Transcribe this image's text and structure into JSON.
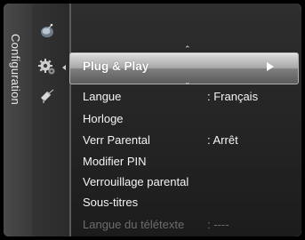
{
  "sidebar": {
    "title": "Configuration",
    "icons": [
      "antenna-icon",
      "gear-icon",
      "satellite-dish-icon"
    ]
  },
  "menu": {
    "selected": {
      "label": "Plug & Play"
    },
    "items": [
      {
        "label": "Langue",
        "value": ": Français"
      },
      {
        "label": "Horloge",
        "value": ""
      },
      {
        "label": "Verr Parental",
        "value": ": Arrêt"
      },
      {
        "label": "Modifier PIN",
        "value": ""
      },
      {
        "label": "Verrouillage parental",
        "value": ""
      },
      {
        "label": "Sous-titres",
        "value": ""
      },
      {
        "label": "Langue du télétexte",
        "value": ": ----",
        "disabled": true
      }
    ]
  },
  "colors": {
    "highlight": "#a8a8a8",
    "background": "#1c1c1c",
    "text": "#f4f4f4",
    "disabled_text": "#6c6c6c"
  }
}
